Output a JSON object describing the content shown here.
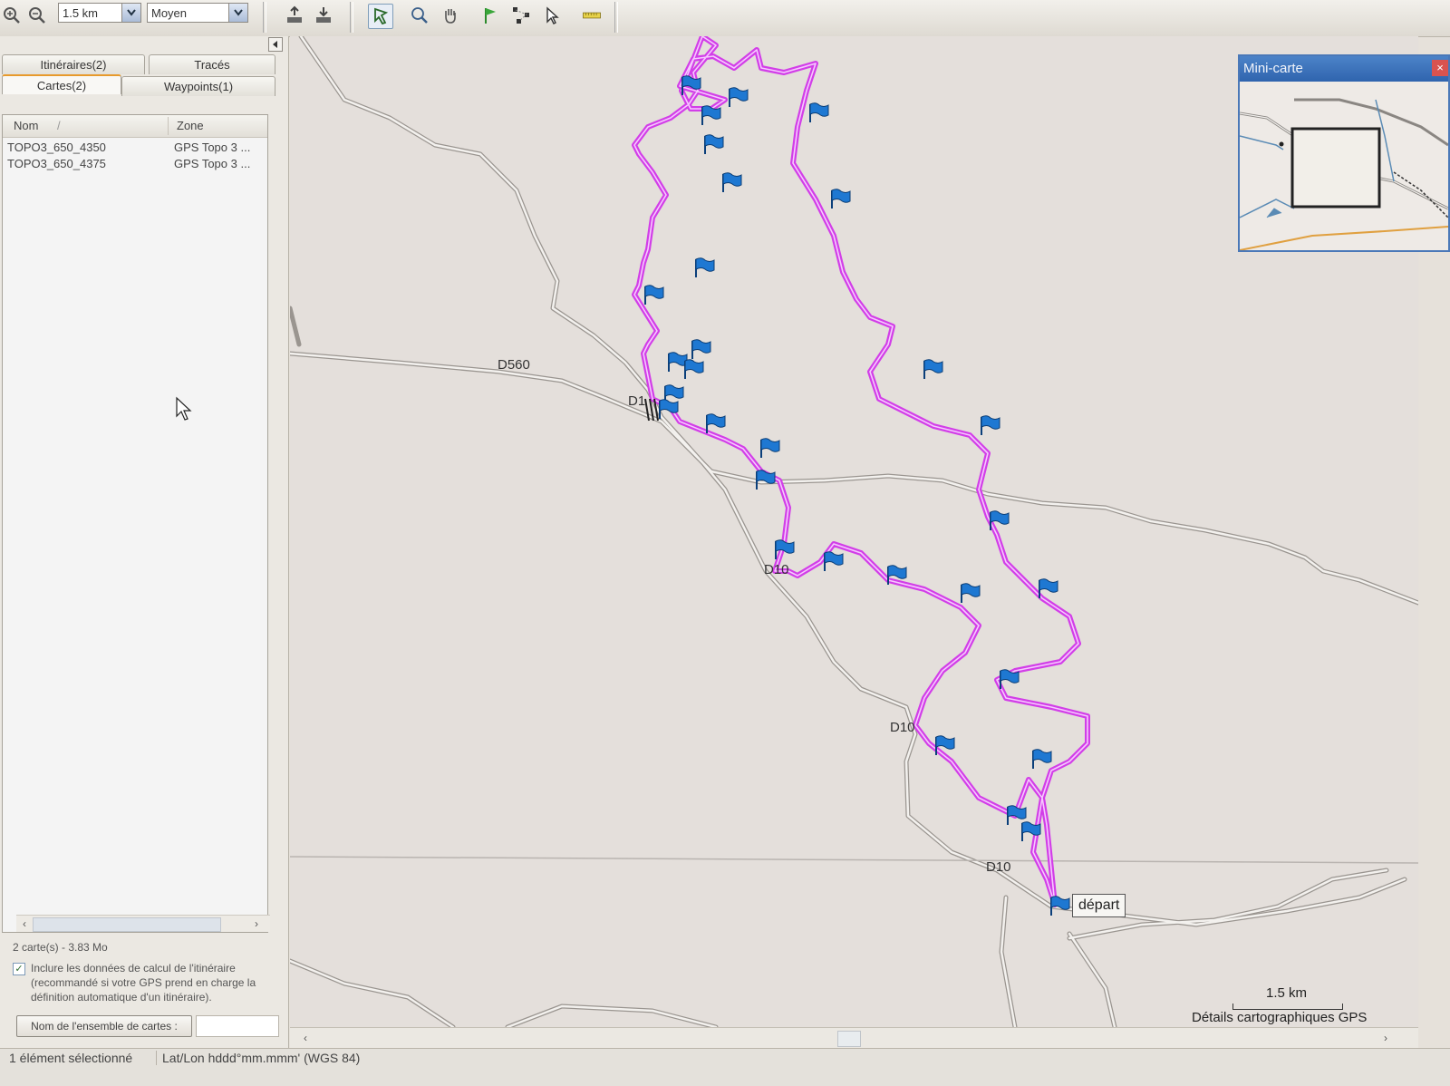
{
  "toolbar": {
    "scale_value": "1.5 km",
    "detail_value": "Moyen",
    "icons": [
      "zoom-in-icon",
      "zoom-out-icon",
      "send-to-device-icon",
      "receive-from-device-icon",
      "selection-tool-icon",
      "zoom-tool-icon",
      "hand-tool-icon",
      "waypoint-tool-icon",
      "route-tool-icon",
      "pointer-tool-icon",
      "measure-tool-icon"
    ]
  },
  "panel": {
    "tabs": {
      "itineraires": "Itinéraires(2)",
      "traces": "Tracés",
      "cartes": "Cartes(2)",
      "waypoints": "Waypoints(1)"
    },
    "columns": {
      "name": "Nom",
      "sort_indicator": "/",
      "zone": "Zone"
    },
    "rows": [
      {
        "name": "TOPO3_650_4350",
        "zone": "GPS Topo 3 ..."
      },
      {
        "name": "TOPO3_650_4375",
        "zone": "GPS Topo 3 ..."
      }
    ],
    "map_count": "2 carte(s) - 3.83 Mo",
    "route_data_checkbox": "✓",
    "route_data_line1": "Inclure les données de calcul de l'itinéraire",
    "route_data_line2": "(recommandé si votre GPS prend en charge la",
    "route_data_line3": "définition automatique d'un itinéraire).",
    "mapset_button": "Nom de l'ensemble de cartes :"
  },
  "map": {
    "road_labels": {
      "d560": "D560",
      "d10_a": "D1",
      "d10_b": "D10",
      "d10_c": "D10",
      "d10_d": "D10"
    },
    "start_label": "départ",
    "scale_text": "1.5 km",
    "details_text": "Détails cartographiques GPS",
    "track_color": "#d23ee8",
    "flag_color": "#1e78d2"
  },
  "minimap": {
    "title": "Mini-carte",
    "close": "×"
  },
  "status": {
    "selection": "1 élément sélectionné",
    "coords": "Lat/Lon hddd°mm.mmm' (WGS 84)"
  }
}
